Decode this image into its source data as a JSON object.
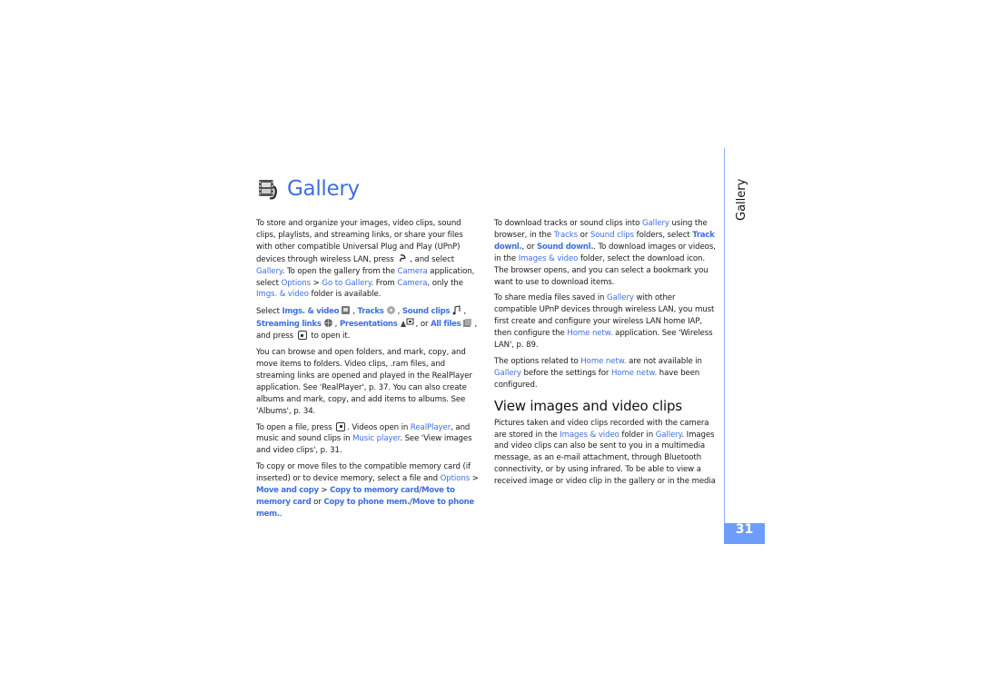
{
  "title": "Gallery",
  "title_icon": "gallery-film-icon",
  "side_tab": "Gallery",
  "page_number": "31",
  "colors": {
    "link": "#3f6fe0",
    "tab": "#6e9cfa",
    "rule": "#8fb0f5"
  },
  "col1": {
    "p1": {
      "t1": "To store and organize your images, video clips, sound clips, playlists, and streaming links, or share your files with other compatible Universal Plug and Play (UPnP) devices through wireless LAN, press ",
      "t2": ", and select ",
      "l1": "Gallery",
      "t3": ". To open the gallery from the ",
      "l2": "Camera",
      "t4": " application, select ",
      "l3": "Options",
      "t5": " > ",
      "l4": "Go to Gallery",
      "t6": ". From ",
      "l5": "Camera",
      "t7": ", only the ",
      "l6": "Imgs. & video",
      "t8": " folder is available."
    },
    "p2": {
      "t1": "Select ",
      "l1": "Imgs. & video",
      "t2": ", ",
      "l2": "Tracks",
      "t3": ", ",
      "l3": "Sound clips",
      "t4": ", ",
      "l4": "Streaming links",
      "t5": ", ",
      "l5": "Presentations",
      "t6": ", or ",
      "l6": "All files",
      "t7": ", and press ",
      "t8": " to open it."
    },
    "p3": "You can browse and open folders, and mark, copy, and move items to folders. Video clips, .ram files, and streaming links are opened and played in the RealPlayer application. See 'RealPlayer', p. 37. You can also create albums and mark, copy, and add items to albums. See 'Albums', p. 34.",
    "p4": {
      "t1": "To open a file, press ",
      "t2": ". Videos open in ",
      "l1": "RealPlayer",
      "t3": ", and music and sound clips in ",
      "l2": "Music player",
      "t4": ". See 'View images and video clips', p. 31."
    },
    "p5": {
      "t1": "To copy or move files to the compatible memory card (if inserted) or to device memory, select a file and ",
      "l1": "Options",
      "t2": " > ",
      "l2": "Move and copy",
      "t3": " > ",
      "l3": "Copy to memory card",
      "t4": "/",
      "l4": "Move to memory card",
      "t5": " or ",
      "l5": "Copy to phone mem.",
      "t6": "/",
      "l6": "Move to phone mem.",
      "t7": "."
    }
  },
  "col2": {
    "p1": {
      "t1": "To download tracks or sound clips into ",
      "l1": "Gallery",
      "t2": " using the browser, in the ",
      "l2": "Tracks",
      "t3": " or ",
      "l3": "Sound clips",
      "t4": " folders, select ",
      "l4": "Track downl.",
      "t5": ", or ",
      "l5": "Sound downl.",
      "t6": ". To download images or videos, in the ",
      "l6": "Images & video",
      "t7": " folder, select the download icon. The browser opens, and you can select a bookmark you want to use to download items."
    },
    "p2": {
      "t1": "To share media files saved in ",
      "l1": "Gallery",
      "t2": " with other compatible UPnP devices through wireless LAN, you must first create and configure your wireless LAN home IAP, then configure the ",
      "l2": "Home netw.",
      "t3": " application. See 'Wireless LAN', p. 89."
    },
    "p3": {
      "t1": "The options related to ",
      "l1": "Home netw.",
      "t2": " are not available in ",
      "l2": "Gallery",
      "t3": " before the settings for ",
      "l3": "Home netw.",
      "t4": " have been configured."
    },
    "section_heading": "View images and video clips",
    "p4": {
      "t1": "Pictures taken and video clips recorded with the camera are stored in the ",
      "l1": "Images & video",
      "t2": " folder in ",
      "l2": "Gallery",
      "t3": ". Images and video clips can also be sent to you in a multimedia message, as an e-mail attachment, through Bluetooth connectivity, or by using infrared. To be able to view a received image or video clip in the gallery or in the media"
    }
  }
}
